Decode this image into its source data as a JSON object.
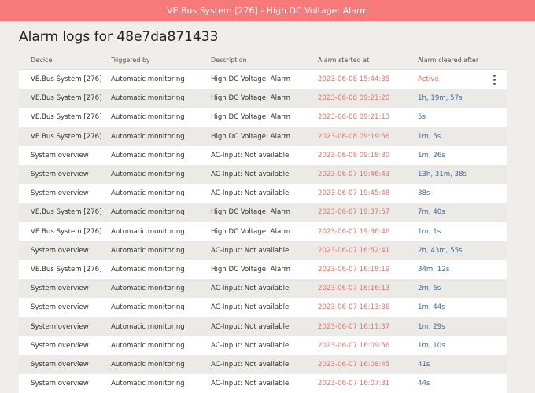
{
  "banner": {
    "text": "VE.Bus System [276] - High DC Voltage: Alarm"
  },
  "page": {
    "title": "Alarm logs for 48e7da871433"
  },
  "table": {
    "headers": [
      "Device",
      "Triggered by",
      "Description",
      "Alarm started at",
      "Alarm cleared after"
    ],
    "rows": [
      {
        "device": "VE.Bus System [276]",
        "triggered": "Automatic monitoring",
        "description": "High DC Voltage: Alarm",
        "started": "2023-06-08 15:44:35",
        "cleared": "Active"
      },
      {
        "device": "VE.Bus System [276]",
        "triggered": "Automatic monitoring",
        "description": "High DC Voltage: Alarm",
        "started": "2023-06-08 09:21:20",
        "cleared": "1h, 19m, 57s"
      },
      {
        "device": "VE.Bus System [276]",
        "triggered": "Automatic monitoring",
        "description": "High DC Voltage: Alarm",
        "started": "2023-06-08 09:21:13",
        "cleared": "5s"
      },
      {
        "device": "VE.Bus System [276]",
        "triggered": "Automatic monitoring",
        "description": "High DC Voltage: Alarm",
        "started": "2023-06-08 09:19:56",
        "cleared": "1m, 5s"
      },
      {
        "device": "System overview",
        "triggered": "Automatic monitoring",
        "description": "AC-Input: Not available",
        "started": "2023-06-08 09:18:30",
        "cleared": "1m, 26s"
      },
      {
        "device": "System overview",
        "triggered": "Automatic monitoring",
        "description": "AC-Input: Not available",
        "started": "2023-06-07 19:46:43",
        "cleared": "13h, 31m, 38s"
      },
      {
        "device": "System overview",
        "triggered": "Automatic monitoring",
        "description": "AC-Input: Not available",
        "started": "2023-06-07 19:45:48",
        "cleared": "38s"
      },
      {
        "device": "VE.Bus System [276]",
        "triggered": "Automatic monitoring",
        "description": "High DC Voltage: Alarm",
        "started": "2023-06-07 19:37:57",
        "cleared": "7m, 40s"
      },
      {
        "device": "VE.Bus System [276]",
        "triggered": "Automatic monitoring",
        "description": "High DC Voltage: Alarm",
        "started": "2023-06-07 19:36:46",
        "cleared": "1m, 1s"
      },
      {
        "device": "System overview",
        "triggered": "Automatic monitoring",
        "description": "AC-Input: Not available",
        "started": "2023-06-07 16:52:41",
        "cleared": "2h, 43m, 55s"
      },
      {
        "device": "VE.Bus System [276]",
        "triggered": "Automatic monitoring",
        "description": "High DC Voltage: Alarm",
        "started": "2023-06-07 16:18:19",
        "cleared": "34m, 12s"
      },
      {
        "device": "System overview",
        "triggered": "Automatic monitoring",
        "description": "AC-Input: Not available",
        "started": "2023-06-07 16:16:13",
        "cleared": "2m, 6s"
      },
      {
        "device": "System overview",
        "triggered": "Automatic monitoring",
        "description": "AC-Input: Not available",
        "started": "2023-06-07 16:13:36",
        "cleared": "1m, 44s"
      },
      {
        "device": "System overview",
        "triggered": "Automatic monitoring",
        "description": "AC-Input: Not available",
        "started": "2023-06-07 16:11:37",
        "cleared": "1m, 29s"
      },
      {
        "device": "System overview",
        "triggered": "Automatic monitoring",
        "description": "AC-Input: Not available",
        "started": "2023-06-07 16:09:56",
        "cleared": "1m, 10s"
      },
      {
        "device": "System overview",
        "triggered": "Automatic monitoring",
        "description": "AC-Input: Not available",
        "started": "2023-06-07 16:08:45",
        "cleared": "41s"
      },
      {
        "device": "System overview",
        "triggered": "Automatic monitoring",
        "description": "AC-Input: Not available",
        "started": "2023-06-07 16:07:31",
        "cleared": "44s"
      }
    ]
  },
  "colors": {
    "banner": "#f77a7a",
    "started": "#e2726d",
    "cleared": "#3a6ea5",
    "active": "#e2726d"
  },
  "icons": {
    "row_menu": "kebab-menu-icon"
  }
}
